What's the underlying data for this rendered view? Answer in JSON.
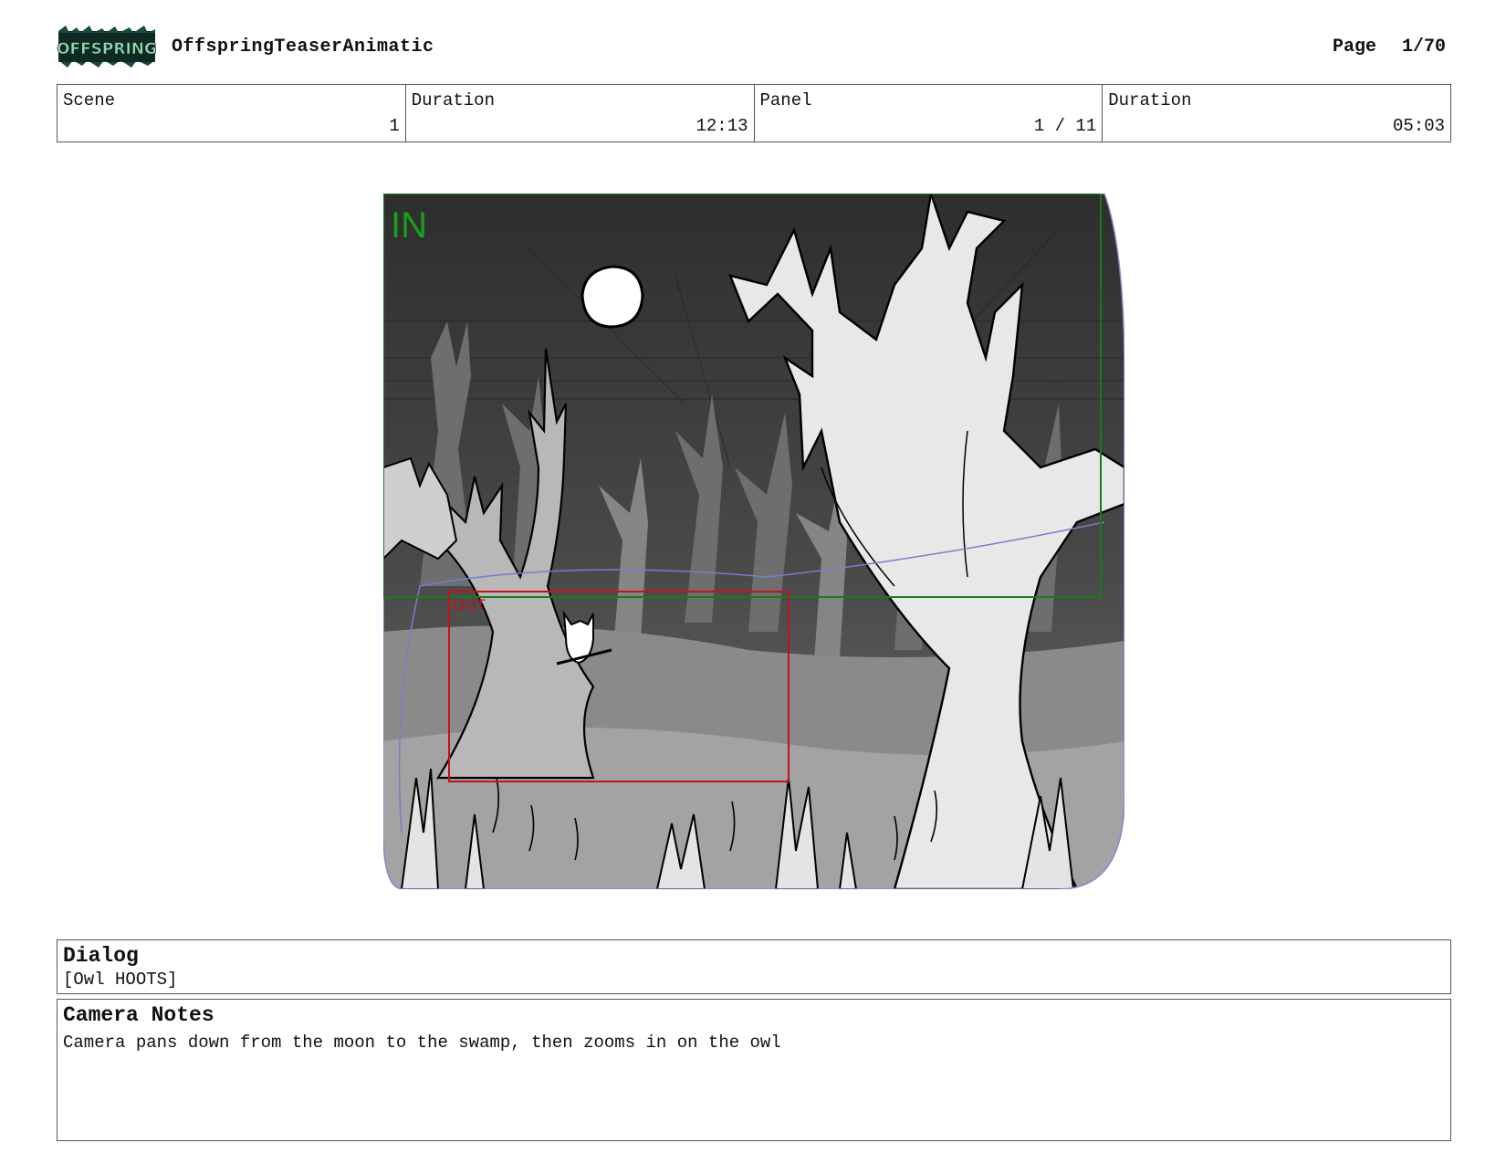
{
  "header": {
    "logo_text": "OFFSPRING",
    "project_title": "OffspringTeaserAnimatic",
    "page_label": "Page",
    "page_number": "1/70"
  },
  "info": {
    "scene_label": "Scene",
    "scene_value": "1",
    "scene_duration_label": "Duration",
    "scene_duration_value": "12:13",
    "panel_label": "Panel",
    "panel_value": "1 / 11",
    "panel_duration_label": "Duration",
    "panel_duration_value": "05:03"
  },
  "panel": {
    "in_label": "IN",
    "out_label": "OUT",
    "in_color": "#1a9e1a",
    "out_color": "#c0141a"
  },
  "dialog": {
    "heading": "Dialog",
    "text": "[Owl HOOTS]"
  },
  "camera_notes": {
    "heading": "Camera Notes",
    "text": "Camera pans down from the moon to the swamp, then zooms in on the owl"
  }
}
